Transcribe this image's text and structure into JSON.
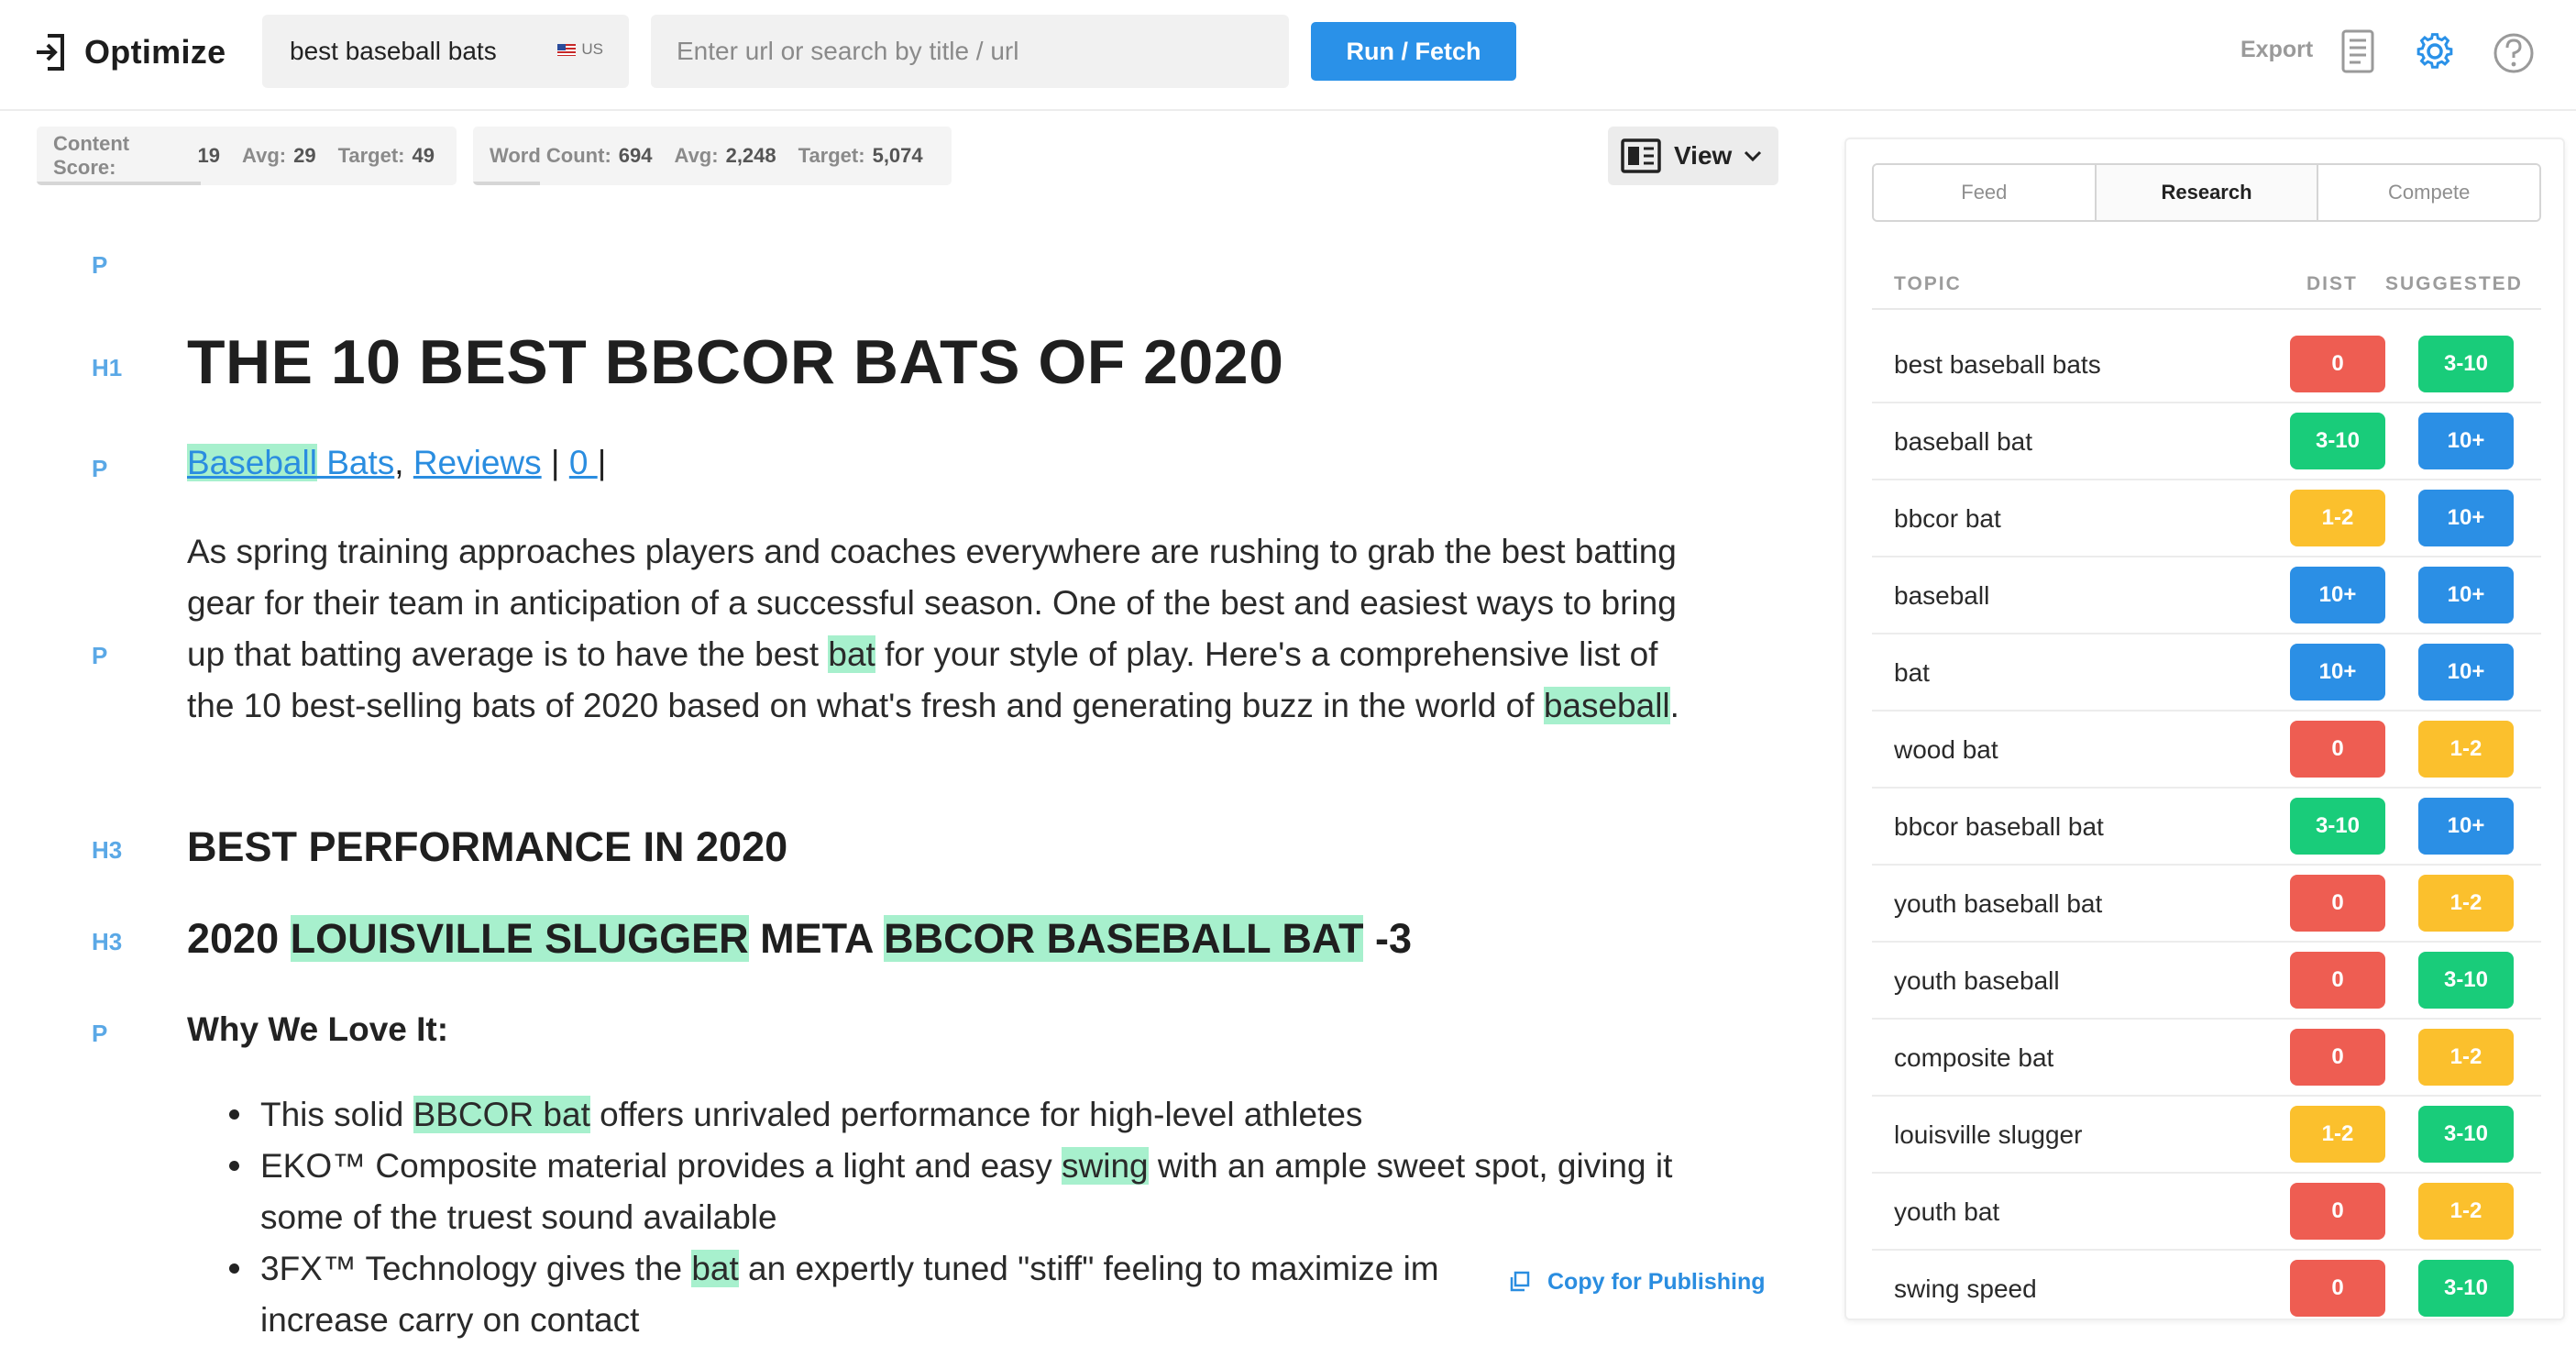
{
  "app": {
    "title": "Optimize"
  },
  "search": {
    "keyword": "best baseball bats",
    "country": "US",
    "url_placeholder": "Enter url or search by title / url"
  },
  "toolbar": {
    "run_label": "Run / Fetch",
    "export_label": "Export"
  },
  "scores": {
    "content_label": "Content Score:",
    "content_value": "19",
    "content_avg_label": "Avg:",
    "content_avg": "29",
    "content_target_label": "Target:",
    "content_target": "49",
    "word_label": "Word Count:",
    "word_value": "694",
    "word_avg_label": "Avg:",
    "word_avg": "2,248",
    "word_target_label": "Target:",
    "word_target": "5,074"
  },
  "view": {
    "label": "View"
  },
  "editor": {
    "tags": {
      "p": "P",
      "h1": "H1",
      "h3": "H3"
    },
    "h1": "THE 10 BEST BBCOR BATS OF 2020",
    "meta": {
      "link1_hl": "Baseball",
      "link1_rest": " Bats",
      "comma": ",",
      "link2": "Reviews",
      "sep": " | ",
      "link3": "0 ",
      "sep2": " |"
    },
    "para": {
      "t1": "As spring training approaches players and coaches everywhere are rushing to grab the best batting gear for their team in anticipation of a successful season. One of the best and easiest ways to bring up that batting average is to have the best ",
      "hl1": "bat",
      "t2": " for your style of play. Here's a comprehensive list of the 10 best-selling bats of 2020 based on what's fresh and generating buzz in the world of ",
      "hl2": "baseball",
      "t3": "."
    },
    "h3_a": "BEST PERFORMANCE IN 2020",
    "h3_b": {
      "t1": "2020 ",
      "hl1": "LOUISVILLE SLUGGER",
      "t2": " META ",
      "hl2": "BBCOR BASEBALL BAT",
      "t3": " -3"
    },
    "why": "Why We Love It:",
    "bullets": {
      "b1": {
        "t1": "This solid ",
        "hl": "BBCOR bat",
        "t2": " offers unrivaled performance for high-level athletes"
      },
      "b2": {
        "t1": "EKO™ Composite material provides a light and easy ",
        "hl": "swing",
        "t2": " with an ample sweet spot, giving it some of the truest sound available"
      },
      "b3": {
        "t1": "3FX™ Technology gives the ",
        "hl": "bat",
        "t2": " an expertly tuned \"stiff\" feeling to maximize im"
      },
      "b3_cont": "increase carry on contact"
    },
    "copy_label": "Copy for Publishing"
  },
  "panel": {
    "tabs": [
      "Feed",
      "Research",
      "Compete"
    ],
    "active_tab": "Research",
    "headers": {
      "topic": "TOPIC",
      "dist": "DIST",
      "suggested": "SUGGESTED"
    },
    "rows": [
      {
        "topic": "best baseball bats",
        "dist": "0",
        "dist_color": "#ee5d52",
        "suggested": "3-10",
        "suggested_color": "#19cc7a"
      },
      {
        "topic": "baseball bat",
        "dist": "3-10",
        "dist_color": "#19cc7a",
        "suggested": "10+",
        "suggested_color": "#2b8fe5"
      },
      {
        "topic": "bbcor bat",
        "dist": "1-2",
        "dist_color": "#fbc02d",
        "suggested": "10+",
        "suggested_color": "#2b8fe5"
      },
      {
        "topic": "baseball",
        "dist": "10+",
        "dist_color": "#2b8fe5",
        "suggested": "10+",
        "suggested_color": "#2b8fe5"
      },
      {
        "topic": "bat",
        "dist": "10+",
        "dist_color": "#2b8fe5",
        "suggested": "10+",
        "suggested_color": "#2b8fe5"
      },
      {
        "topic": "wood bat",
        "dist": "0",
        "dist_color": "#ee5d52",
        "suggested": "1-2",
        "suggested_color": "#fbc02d"
      },
      {
        "topic": "bbcor baseball bat",
        "dist": "3-10",
        "dist_color": "#19cc7a",
        "suggested": "10+",
        "suggested_color": "#2b8fe5"
      },
      {
        "topic": "youth baseball bat",
        "dist": "0",
        "dist_color": "#ee5d52",
        "suggested": "1-2",
        "suggested_color": "#fbc02d"
      },
      {
        "topic": "youth baseball",
        "dist": "0",
        "dist_color": "#ee5d52",
        "suggested": "3-10",
        "suggested_color": "#19cc7a"
      },
      {
        "topic": "composite bat",
        "dist": "0",
        "dist_color": "#ee5d52",
        "suggested": "1-2",
        "suggested_color": "#fbc02d"
      },
      {
        "topic": "louisville slugger",
        "dist": "1-2",
        "dist_color": "#fbc02d",
        "suggested": "3-10",
        "suggested_color": "#19cc7a"
      },
      {
        "topic": "youth bat",
        "dist": "0",
        "dist_color": "#ee5d52",
        "suggested": "1-2",
        "suggested_color": "#fbc02d"
      },
      {
        "topic": "swing speed",
        "dist": "0",
        "dist_color": "#ee5d52",
        "suggested": "3-10",
        "suggested_color": "#19cc7a"
      }
    ]
  },
  "icons": {
    "logo": "exit-bracket-icon",
    "document": "document-icon",
    "settings": "gear-icon",
    "help": "question-circle-icon",
    "view": "layout-icon",
    "chevron": "chevron-down-icon",
    "copy": "copy-icon",
    "flag": "us-flag-icon"
  },
  "colors": {
    "accent": "#2a91e8",
    "highlight": "#a7f0cd",
    "tag": "#5aa8e6"
  },
  "progress": {
    "content_score_fraction": 0.39,
    "word_count_fraction": 0.14
  }
}
